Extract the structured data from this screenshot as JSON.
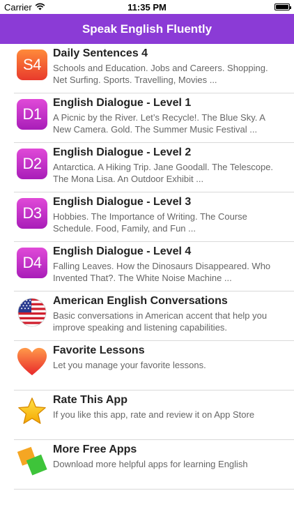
{
  "status": {
    "carrier": "Carrier",
    "time": "11:35 PM"
  },
  "nav": {
    "title": "Speak English Fluently"
  },
  "items": [
    {
      "badge": "S4",
      "title": "Daily Sentences 4",
      "desc": "Schools and Education. Jobs and Careers. Shopping. Net Surfing. Sports. Travelling, Movies ..."
    },
    {
      "badge": "D1",
      "title": "English Dialogue - Level 1",
      "desc": "A Picnic by the River. Let’s Recycle!. The Blue Sky. A New Camera. Gold. The Summer Music Festival ..."
    },
    {
      "badge": "D2",
      "title": "English Dialogue - Level 2",
      "desc": "Antarctica.  A Hiking Trip. Jane Goodall. The Telescope. The Mona Lisa. An Outdoor Exhibit ..."
    },
    {
      "badge": "D3",
      "title": "English Dialogue - Level 3",
      "desc": "Hobbies. The Importance of Writing. The Course Schedule. Food, Family, and Fun ..."
    },
    {
      "badge": "D4",
      "title": "English Dialogue - Level 4",
      "desc": "Falling Leaves. How the Dinosaurs Disappeared. Who Invented That?. The White Noise Machine ..."
    },
    {
      "icon": "us-flag-icon",
      "title": "American English Conversations",
      "desc": "Basic conversations in American accent that help you improve speaking and listening capabilities."
    },
    {
      "icon": "heart-icon",
      "title": "Favorite Lessons",
      "desc": "Let you manage your favorite lessons."
    },
    {
      "icon": "star-icon",
      "title": "Rate This App",
      "desc": "If you like this app, rate and review it on App Store"
    },
    {
      "icon": "apps-icon",
      "title": "More Free Apps",
      "desc": "Download more helpful apps for learning English"
    }
  ],
  "colors": {
    "nav_bar": "#8b3bd6",
    "badge_orange": "#f0612f",
    "badge_purple": "#c733c9"
  }
}
